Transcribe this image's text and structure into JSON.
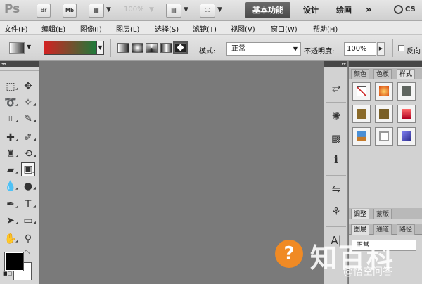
{
  "appbar": {
    "logo": "Ps",
    "bridge_label": "Br",
    "minibridge_label": "Mb",
    "zoom": "100%",
    "workspaces": [
      "基本功能",
      "设计",
      "绘画"
    ],
    "more": "»",
    "cs_live": "CS"
  },
  "menubar": {
    "items": [
      "文件(F)",
      "编辑(E)",
      "图像(I)",
      "图层(L)",
      "选择(S)",
      "滤镜(T)",
      "视图(V)",
      "窗口(W)",
      "帮助(H)"
    ]
  },
  "options": {
    "mode_label": "模式:",
    "mode_value": "正常",
    "opacity_label": "不透明度:",
    "opacity_value": "100%",
    "reverse_label": "反向",
    "gradient_colors": [
      "#d32222",
      "#1d7a3a"
    ]
  },
  "tools": {
    "foreground_color": "#000000",
    "background_color": "#ffffff"
  },
  "panels": {
    "top_tabs": [
      "颜色",
      "色板",
      "样式"
    ],
    "adjust_tabs": [
      "调整",
      "蒙版"
    ],
    "layer_tabs": [
      "图层",
      "通道",
      "路径"
    ],
    "layer_blend_mode": "正常"
  },
  "watermark": {
    "logo_glyph": "?",
    "brand": "知百科",
    "user": "@悟空问答"
  }
}
